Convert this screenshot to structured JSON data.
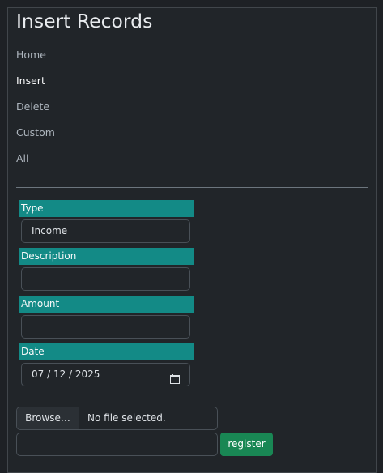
{
  "page": {
    "title": "Insert Records"
  },
  "nav": {
    "items": [
      {
        "label": "Home"
      },
      {
        "label": "Insert"
      },
      {
        "label": "Delete"
      },
      {
        "label": "Custom"
      },
      {
        "label": "All"
      }
    ],
    "active": "Insert"
  },
  "form": {
    "type_label": "Type",
    "type_value": "Income",
    "description_label": "Description",
    "description_value": "",
    "amount_label": "Amount",
    "amount_value": "",
    "date_label": "Date",
    "date_value": "07 / 12 / 2025",
    "file_button": "Browse…",
    "file_status": "No file selected.",
    "text_value": "",
    "submit_label": "register"
  },
  "colors": {
    "background": "#212529",
    "label_bg": "#138a86",
    "button_bg": "#198754"
  },
  "icons": {
    "date": "calendar-icon"
  }
}
